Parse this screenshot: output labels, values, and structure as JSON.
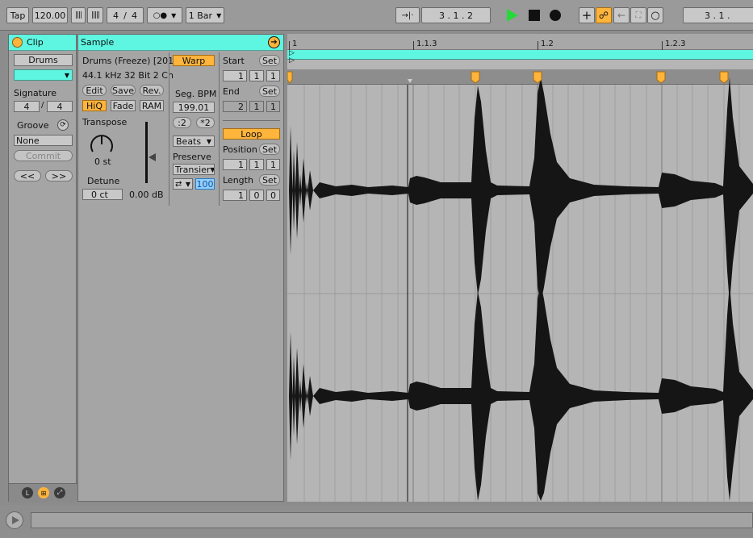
{
  "transport": {
    "tap": "Tap",
    "tempo": "120.00",
    "signature_num": "4",
    "signature_slash": "/",
    "signature_den": "4",
    "quantize": "1 Bar",
    "arrangement_position": "3 .   1 .   2",
    "arrangement_position_right": "3 .   1 ."
  },
  "clip": {
    "header": "Clip",
    "name": "Drums",
    "color": "#5ef5e1",
    "signature_label": "Signature",
    "sig_num": "4",
    "sig_den": "4",
    "groove_label": "Groove",
    "groove_value": "None",
    "commit_label": "Commit",
    "nudge_back": "<<",
    "nudge_fwd": ">>"
  },
  "sample": {
    "header": "Sample",
    "file_name": "Drums (Freeze) [201",
    "file_info": "44.1 kHz 32 Bit 2 Ch",
    "edit": "Edit",
    "save": "Save",
    "rev": "Rev.",
    "hiq": "HiQ",
    "fade": "Fade",
    "ram": "RAM",
    "transpose_label": "Transpose",
    "transpose_value": "0 st",
    "detune_label": "Detune",
    "detune_value": "0 ct",
    "gain_value": "0.00 dB",
    "warp": "Warp",
    "seg_bpm_label": "Seg. BPM",
    "seg_bpm_value": "199.01",
    "half": ":2",
    "double": "*2",
    "warp_mode": "Beats",
    "preserve_label": "Preserve",
    "preserve_value": "Transier",
    "loop_mode_value": "100",
    "start_label": "Start",
    "set": "Set",
    "start_values": [
      "1",
      "1",
      "1"
    ],
    "end_label": "End",
    "end_values": [
      "2",
      "1",
      "1"
    ],
    "loop": "Loop",
    "position_label": "Position",
    "position_values": [
      "1",
      "1",
      "1"
    ],
    "length_label": "Length",
    "length_values": [
      "1",
      "0",
      "0"
    ]
  },
  "ruler": {
    "labels": [
      "1",
      "1.1.3",
      "1.2",
      "1.2.3"
    ]
  },
  "colors": {
    "accent_cyan": "#5ef5e1",
    "accent_orange": "#ffb43c",
    "play_green": "#27d83a"
  }
}
